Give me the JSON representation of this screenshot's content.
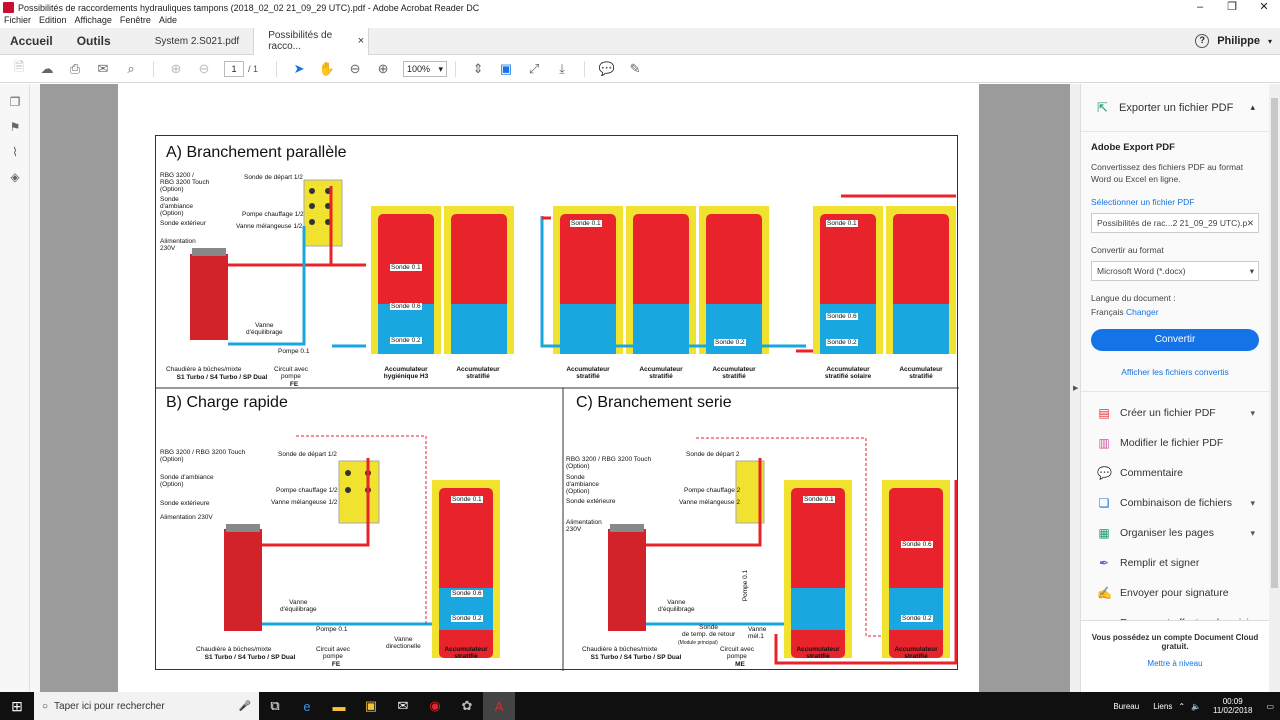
{
  "window": {
    "title": "Possibilités de raccordements hydrauliques tampons (2018_02_02 21_09_29 UTC).pdf - Adobe Acrobat Reader DC",
    "minimize": "–",
    "maximize": "❐",
    "close": "✕"
  },
  "menu": [
    "Fichier",
    "Edition",
    "Affichage",
    "Fenêtre",
    "Aide"
  ],
  "tabs": {
    "home": "Accueil",
    "tools": "Outils",
    "doc1": "System 2.S021.pdf",
    "doc2": "Possibilités de racco...",
    "close": "×",
    "user": "Philippe"
  },
  "toolbar": {
    "page_current": "1",
    "page_total": "/ 1",
    "zoom": "100%"
  },
  "diagram": {
    "sec_a": "A) Branchement parallèle",
    "sec_b": "B) Charge rapide",
    "sec_c": "C) Branchement serie",
    "a_labels": {
      "rbg": "RBG 3200 /\nRBG 3200 Touch\n(Option)",
      "sonde_amb": "Sonde\nd'ambiance\n(Option)",
      "sonde_ext": "Sonde extérieur",
      "alim": "Alimentation\n230V",
      "sonde_dep": "Sonde de départ 1/2",
      "pompe_ch": "Pompe chauffage 1/2",
      "vanne_mel": "Vanne mélangeuse 1/2",
      "vanne_eq": "Vanne\nd'équilibrage",
      "pompe01": "Pompe 0.1",
      "chaud": "Chaudière à bûches/mixte",
      "chaud_b": "S1 Turbo / S4 Turbo / SP Dual",
      "circuit": "Circuit avec\npompe",
      "fe": "FE",
      "acc_h3": "Accumulateur\nhygiénique H3",
      "acc_strat": "Accumulateur\nstratifié",
      "acc_sol": "Accumulateur\nstratifié solaire",
      "s01": "Sonde 0.1",
      "s06": "Sonde 0.6",
      "s02": "Sonde 0.2"
    },
    "b_labels": {
      "rbg": "RBG 3200 / RBG 3200 Touch\n(Option)",
      "sonde_amb": "Sonde d'ambiance\n(Option)",
      "sonde_ext": "Sonde extérieure",
      "alim": "Alimentation 230V",
      "sonde_dep": "Sonde de départ 1/2",
      "pompe_ch": "Pompe chauffage 1/2",
      "vanne_mel": "Vanne mélangeuse 1/2",
      "vanne_eq": "Vanne\nd'équilibrage",
      "pompe01": "Pompe 0.1",
      "vanne_dir": "Vanne\ndirectionelle",
      "fe": "FE"
    },
    "c_labels": {
      "rbg": "RBG 3200 / RBG 3200 Touch\n(Option)",
      "sonde_amb": "Sonde\nd'ambiance\n(Option)",
      "sonde_ext": "Sonde extérieure",
      "alim": "Alimentation\n230V",
      "sonde_dep": "Sonde de départ 2",
      "pompe_ch": "Pompe chauffage 2",
      "vanne_mel": "Vanne mélangeuse 2",
      "vanne_eq": "Vanne\nd'équilibrage",
      "sonde_ret": "Sonde\nde temp. de retour",
      "module": "(Module principal)",
      "pompe01": "Pompe 0.1",
      "vanne_mel1": "Vanne\nmél.1",
      "me": "ME"
    }
  },
  "rightpanel": {
    "export_head": "Exporter un fichier PDF",
    "adobe_export": "Adobe Export PDF",
    "desc": "Convertissez des fichiers PDF au format Word ou Excel en ligne.",
    "select": "Sélectionner un fichier PDF",
    "file": "Possibilités de rac...2 21_09_29 UTC).pdf",
    "convert_to": "Convertir au format",
    "format": "Microsoft Word (*.docx)",
    "lang_label": "Langue du document :",
    "lang": "Français",
    "change": "Changer",
    "convert_btn": "Convertir",
    "show_converted": "Afficher les fichiers convertis",
    "tools": [
      "Créer un fichier PDF",
      "Modifier le fichier PDF",
      "Commentaire",
      "Combinaison de fichiers",
      "Organiser les pages",
      "Remplir et signer",
      "Envoyer pour signature",
      "Envoyer et effectuer le suivi"
    ],
    "footer": "Vous possédez un compte Document Cloud gratuit.",
    "footer_link": "Mettre à niveau"
  },
  "taskbar": {
    "search": "Taper ici pour rechercher",
    "bureau": "Bureau",
    "liens": "Liens",
    "time": "00:09",
    "date": "11/02/2018"
  },
  "colors": {
    "accent": "#1473e6",
    "tank_red": "#e8232b",
    "tank_blue": "#1aa6df",
    "tank_yellow": "#f2e230",
    "boiler": "#d2232a"
  }
}
